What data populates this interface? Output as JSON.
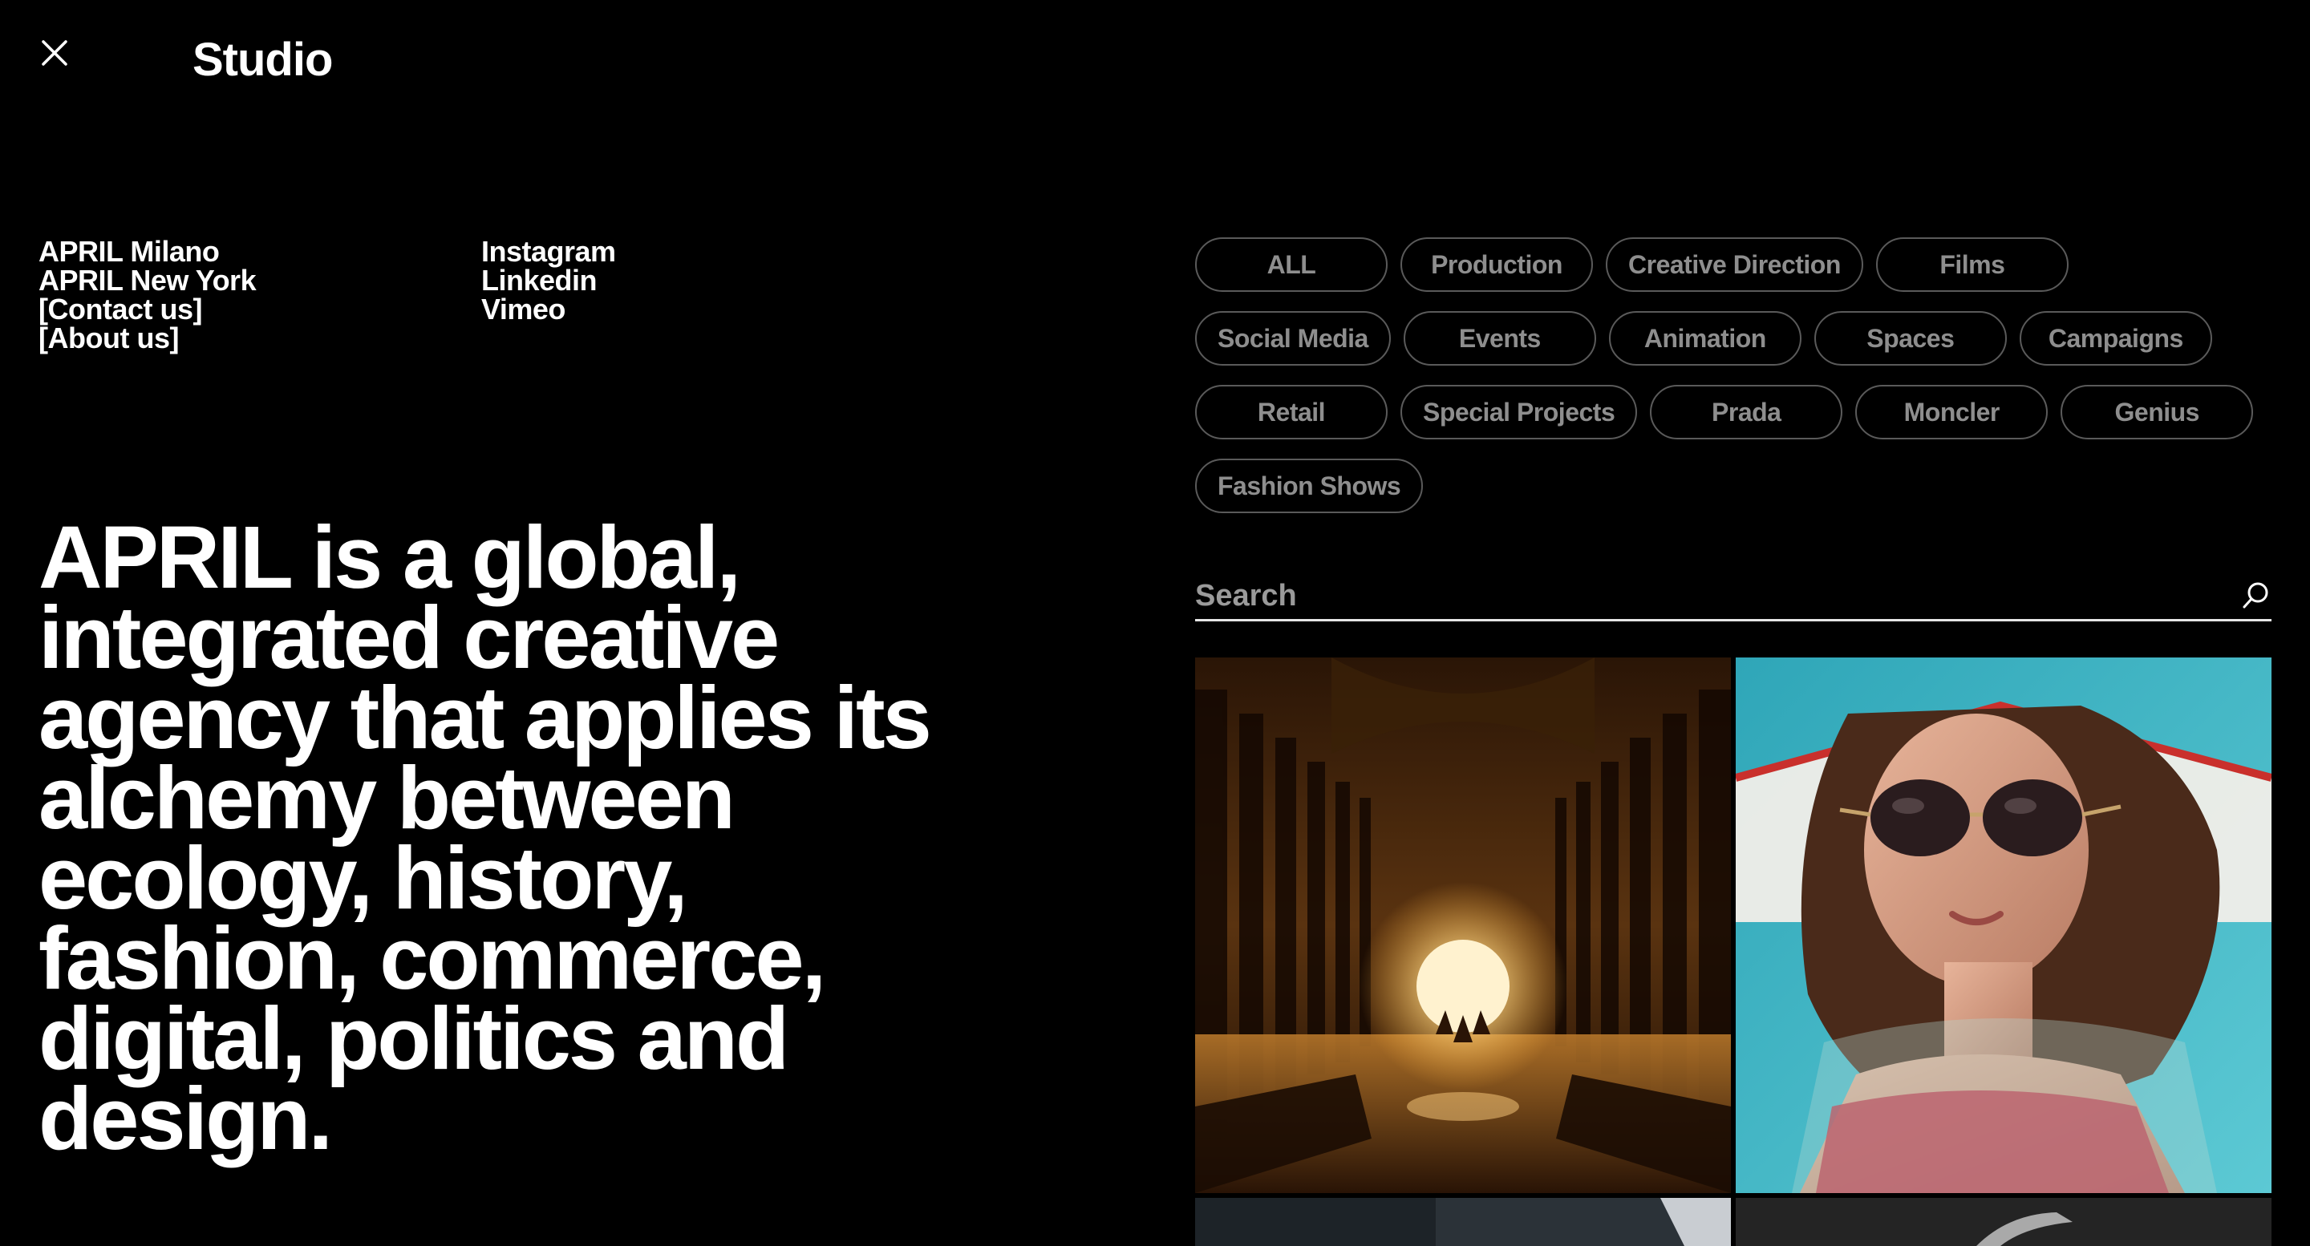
{
  "brand": {
    "title": "Studio"
  },
  "left_links": [
    "APRIL Milano",
    "APRIL New York",
    "[Contact us]",
    "[About us]"
  ],
  "social_links": [
    "Instagram",
    "Linkedin",
    "Vimeo"
  ],
  "headline": "APRIL is a global, integrated creative agency that applies its alchemy between ecology, history, fashion, commerce, digital, politics and design.",
  "filters": {
    "rows": [
      [
        "ALL",
        "Production",
        "Creative Direction",
        "Films"
      ],
      [
        "Social Media",
        "Events",
        "Animation",
        "Spaces",
        "Campaigns"
      ],
      [
        "Retail",
        "Special Projects",
        "Prada",
        "Moncler",
        "Genius"
      ],
      [
        "Fashion Shows"
      ]
    ]
  },
  "search": {
    "placeholder": "Search",
    "value": ""
  },
  "colors": {
    "background": "#000000",
    "text": "#ffffff",
    "chip_border": "#5a5a5a",
    "chip_text": "#8e8e8e",
    "search_underline": "#e6e6e6"
  },
  "icons": {
    "close": "close-icon",
    "search": "search-icon"
  }
}
